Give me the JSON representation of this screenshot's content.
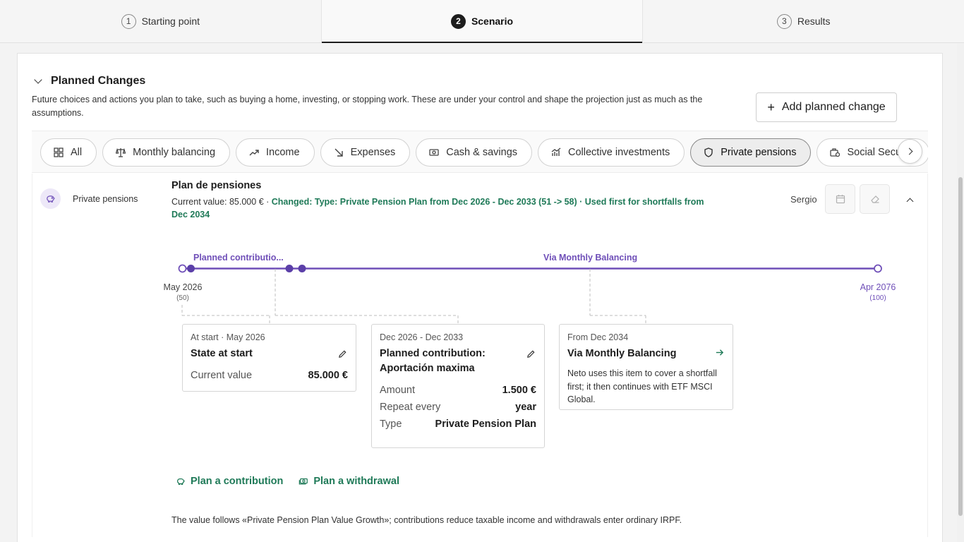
{
  "steps": [
    {
      "num": "1",
      "label": "Starting point"
    },
    {
      "num": "2",
      "label": "Scenario"
    },
    {
      "num": "3",
      "label": "Results"
    }
  ],
  "section": {
    "title": "Planned Changes",
    "description": "Future choices and actions you plan to take, such as buying a home, investing, or stopping work. These are under your control and shape the projection just as much as the assumptions.",
    "add_label": "Add planned change"
  },
  "filters": [
    {
      "label": "All",
      "icon": "grid-icon"
    },
    {
      "label": "Monthly balancing",
      "icon": "scale-icon"
    },
    {
      "label": "Income",
      "icon": "trend-up-icon"
    },
    {
      "label": "Expenses",
      "icon": "arrow-down-right-icon"
    },
    {
      "label": "Cash & savings",
      "icon": "banknote-icon"
    },
    {
      "label": "Collective investments",
      "icon": "chart-icon"
    },
    {
      "label": "Private pensions",
      "icon": "shield-icon"
    },
    {
      "label": "Social Security",
      "icon": "briefcase-icon"
    }
  ],
  "item": {
    "category": "Private pensions",
    "title": "Plan de pensiones",
    "summary_prefix": "Current value: 85.000 € · ",
    "summary_changed": "Changed: Type: Private Pension Plan from Dec 2026 - Dec 2033 (51 -> 58) · Used first for shortfalls from Dec 2034",
    "owner": "Sergio"
  },
  "timeline": {
    "label_contrib": "Planned contributio...",
    "label_balancing": "Via Monthly Balancing",
    "start_date": "May 2026",
    "start_age": "(50)",
    "end_date": "Apr 2076",
    "end_age": "(100)"
  },
  "cards": {
    "start": {
      "meta": "At start · May 2026",
      "title": "State at start",
      "rows": [
        {
          "k": "Current value",
          "v": "85.000 €"
        }
      ]
    },
    "contribution": {
      "meta": "Dec 2026 - Dec 2033",
      "title": "Planned contribution: Aportación maxima",
      "rows": [
        {
          "k": "Amount",
          "v": "1.500 €"
        },
        {
          "k": "Repeat every",
          "v": "year"
        },
        {
          "k": "Type",
          "v": "Private Pension Plan"
        }
      ]
    },
    "balancing": {
      "meta": "From Dec 2034",
      "title": "Via Monthly Balancing",
      "desc": "Neto uses this item to cover a shortfall first; it then continues with ETF MSCI Global."
    }
  },
  "actions": {
    "contribution": "Plan a contribution",
    "withdrawal": "Plan a withdrawal"
  },
  "footnote": "The value follows «Private Pension Plan Value Growth»; contributions reduce taxable income and withdrawals enter ordinary IRPF.",
  "colors": {
    "accent_purple": "#6f4fb8",
    "accent_green": "#1f7a58"
  }
}
